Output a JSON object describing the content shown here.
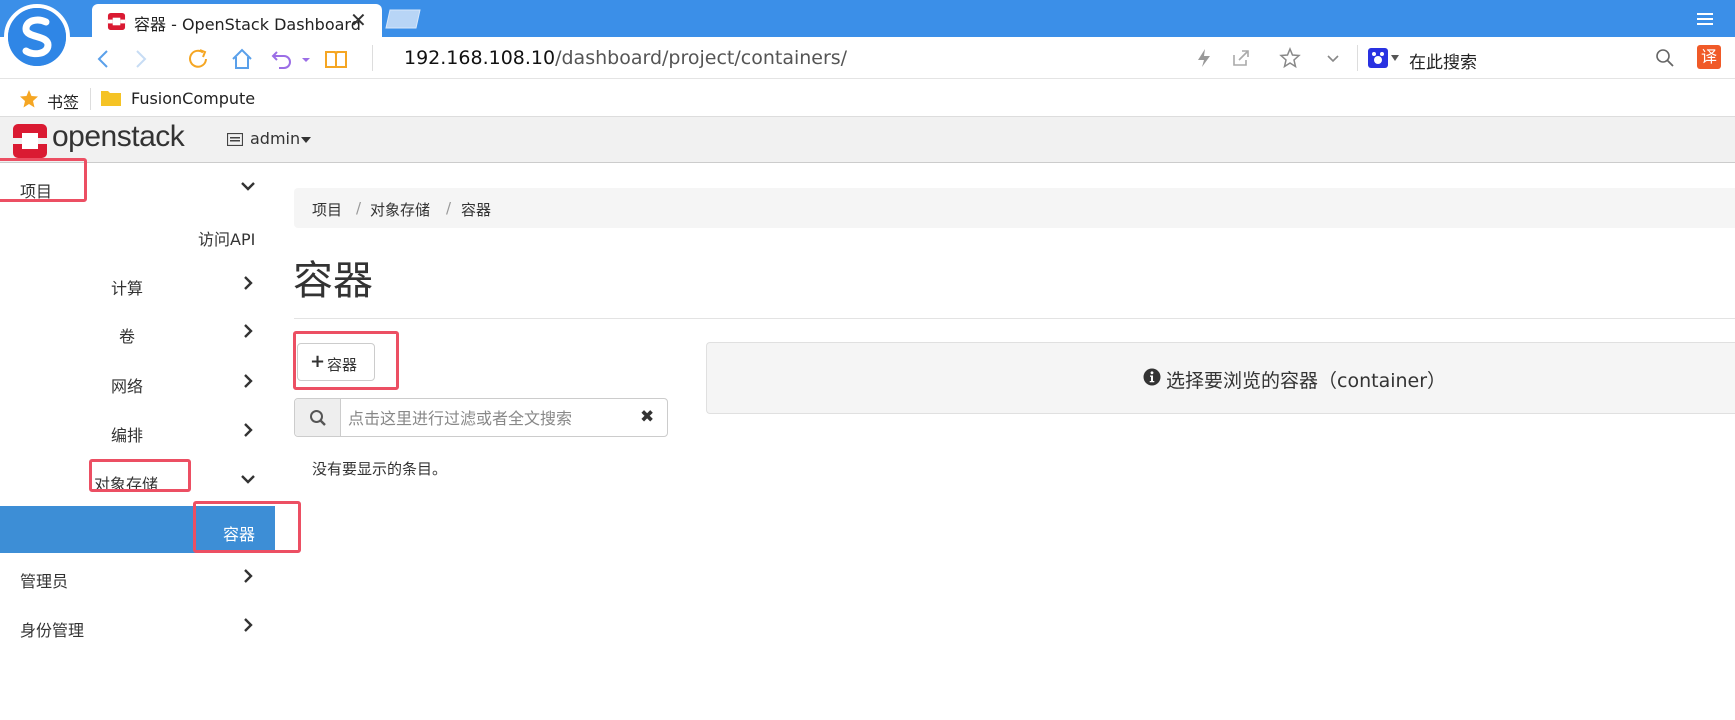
{
  "browser": {
    "tab_title": "容器 - OpenStack Dashboard",
    "tab_close": "✕",
    "url_host": "192.168.108.10",
    "url_path": "/dashboard/project/containers/",
    "search_placeholder": "在此搜索",
    "translate_label": "译",
    "bookmarks": {
      "bookmarks_label": "书签",
      "folder_label": "FusionCompute"
    }
  },
  "header": {
    "logo_text": "openstack",
    "project": "admin"
  },
  "sidebar": {
    "project": "项目",
    "api_access": "访问API",
    "compute": "计算",
    "volumes": "卷",
    "network": "网络",
    "orchestration": "编排",
    "object_store": "对象存储",
    "containers": "容器",
    "admin": "管理员",
    "identity": "身份管理"
  },
  "breadcrumb": {
    "items": [
      "项目",
      "对象存储",
      "容器"
    ],
    "separator": "/"
  },
  "main": {
    "page_title": "容器",
    "add_button_label": "容器",
    "filter_placeholder": "点击这里进行过滤或者全文搜索",
    "empty_message": "没有要显示的条目。",
    "info_message": "选择要浏览的容器（container）"
  },
  "colors": {
    "browser_blue": "#3b8fe8",
    "active_nav": "#3d8ed6",
    "highlight_red": "#ec4f63",
    "openstack_red": "#da1a32"
  }
}
